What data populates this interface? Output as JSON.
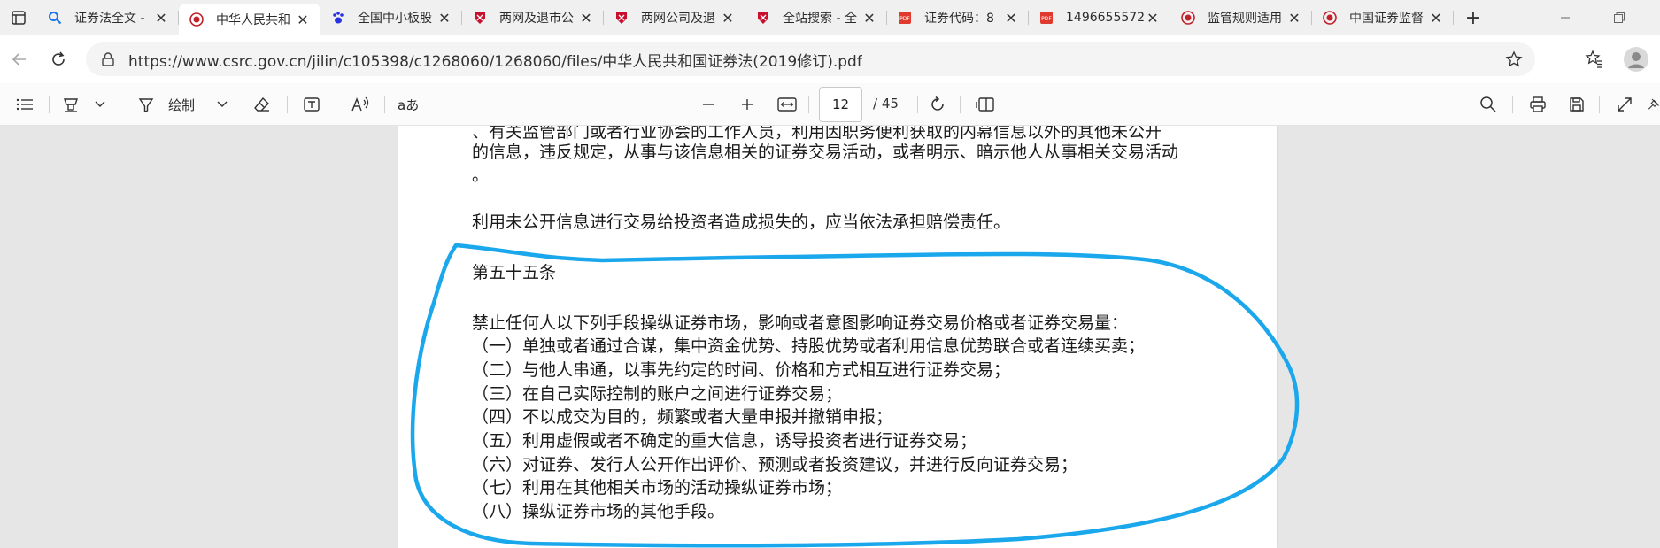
{
  "tabs": [
    {
      "title": "证券法全文 -",
      "favicon": "search-favicon",
      "active": false
    },
    {
      "title": "中华人民共和",
      "favicon": "csrc-favicon",
      "active": true
    },
    {
      "title": "全国中小板股",
      "favicon": "baidu-paw-favicon",
      "active": false
    },
    {
      "title": "两网及退市公",
      "favicon": "red-shield-favicon",
      "active": false
    },
    {
      "title": "两网公司及退",
      "favicon": "red-shield-favicon",
      "active": false
    },
    {
      "title": "全站搜索 - 全",
      "favicon": "red-shield-favicon",
      "active": false
    },
    {
      "title": "证券代码：8",
      "favicon": "pdf-favicon",
      "active": false
    },
    {
      "title": "1496655572",
      "favicon": "pdf-favicon",
      "active": false
    },
    {
      "title": "监管规则适用",
      "favicon": "csrc-favicon",
      "active": false
    },
    {
      "title": "中国证券监督",
      "favicon": "csrc-favicon",
      "active": false
    }
  ],
  "address": {
    "url": "https://www.csrc.gov.cn/jilin/c105398/c1268060/1268060/files/中华人民共和国证券法(2019修订).pdf"
  },
  "pdf_toolbar": {
    "draw_label": "绘制",
    "read_aloud_label": "aあ",
    "page_current": "12",
    "page_total": "/ 45"
  },
  "document": {
    "lines": [
      "、有关监管部门或者行业协会的工作人员，利用因职务便利获取的内幕信息以外的其他未公开",
      "的信息，违反规定，从事与该信息相关的证券交易活动，或者明示、暗示他人从事相关交易活动",
      "。",
      "利用未公开信息进行交易给投资者造成损失的，应当依法承担赔偿责任。",
      "第五十五条",
      "禁止任何人以下列手段操纵证券市场，影响或者意图影响证券交易价格或者证券交易量：",
      "（一）单独或者通过合谋，集中资金优势、持股优势或者利用信息优势联合或者连续买卖；",
      "（二）与他人串通，以事先约定的时间、价格和方式相互进行证券交易；",
      "（三）在自己实际控制的账户之间进行证券交易；",
      "（四）不以成交为目的，频繁或者大量申报并撤销申报；",
      "（五）利用虚假或者不确定的重大信息，诱导投资者进行证券交易；",
      "（六）对证券、发行人公开作出评价、预测或者投资建议，并进行反向证券交易；",
      "（七）利用在其他相关市场的活动操纵证券市场；",
      "（八）操纵证券市场的其他手段。"
    ]
  },
  "colors": {
    "annotation": "#1aa7ec",
    "csrc_red": "#c0202a",
    "pdf_red": "#e03a2e",
    "baidu_blue": "#2932e1"
  }
}
